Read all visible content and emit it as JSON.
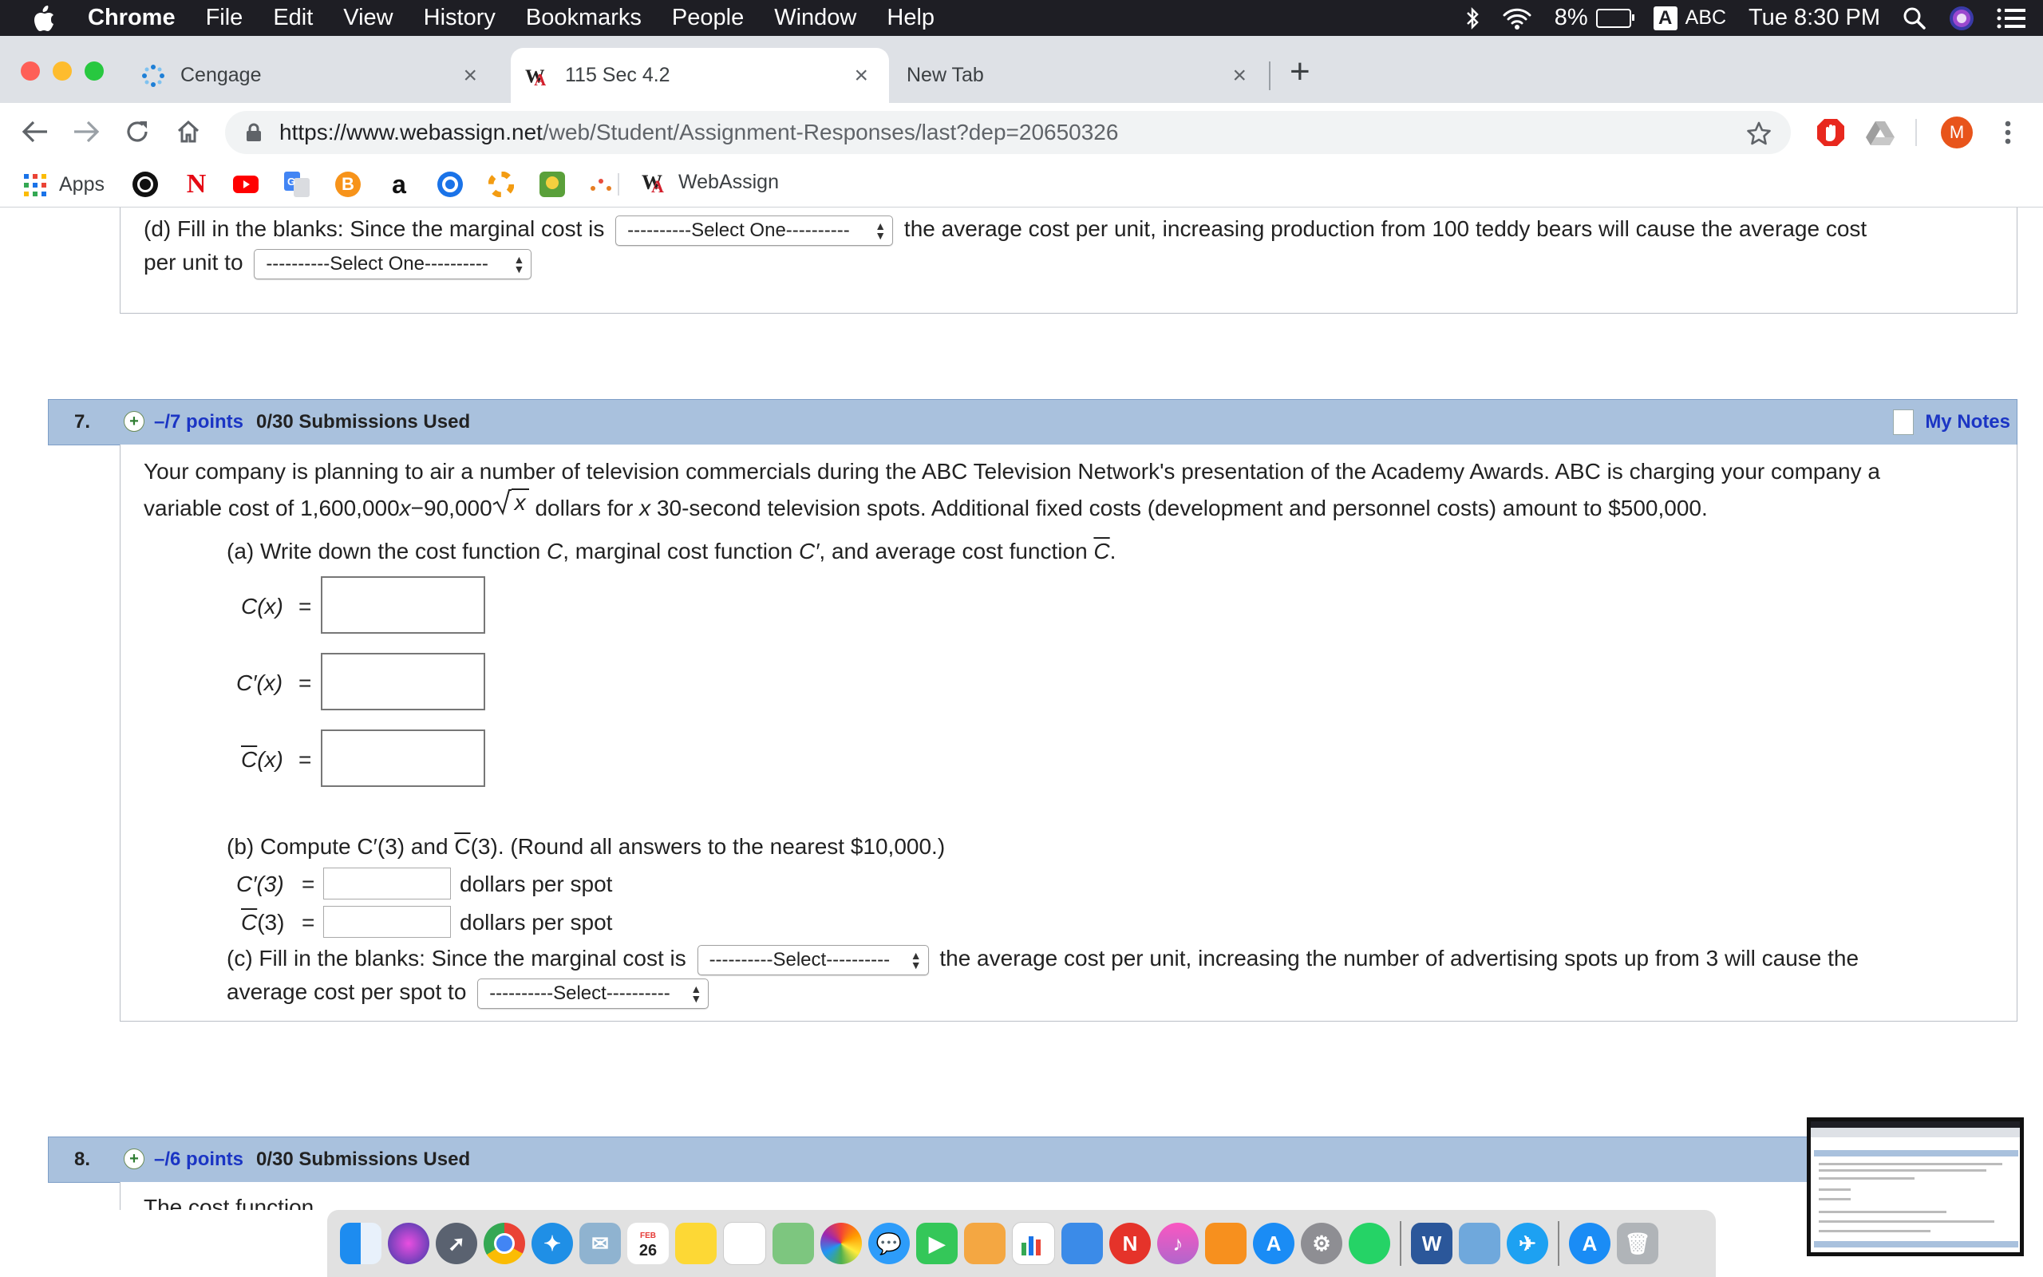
{
  "menubar": {
    "app": "Chrome",
    "items": [
      "File",
      "Edit",
      "View",
      "History",
      "Bookmarks",
      "People",
      "Window",
      "Help"
    ],
    "battery": "8%",
    "input_source": "ABC",
    "input_letter": "A",
    "clock": "Tue 8:30 PM"
  },
  "tabs": [
    {
      "title": "Cengage"
    },
    {
      "title": "115 Sec 4.2"
    },
    {
      "title": "New Tab"
    }
  ],
  "tab_close": "×",
  "new_tab_label": "+",
  "toolbar": {
    "url_host": "https://www.webassign.net",
    "url_path": "/web/Student/Assignment-Responses/last?dep=20650326",
    "profile_initial": "M"
  },
  "bookmarks": {
    "apps_label": "Apps",
    "webassign_label": "WebAssign"
  },
  "prev_question": {
    "part_d_text_1": "(d) Fill in the blanks: Since the marginal cost is",
    "select_1": "----------Select One----------",
    "part_d_text_2": "the average cost per unit, increasing production from 100 teddy bears will cause the average cost",
    "part_d_text_3": "per unit to",
    "select_2": "----------Select One----------"
  },
  "q7": {
    "number": "7.",
    "points": "–/7 points",
    "submissions": "0/30 Submissions Used",
    "my_notes": "My Notes",
    "intro_line1": "Your company is planning to air a number of television commercials during the ABC Television Network's presentation of the Academy Awards. ABC is charging your company a",
    "intro_line2_a": "variable cost of  1,600,000",
    "intro_var_x": "x",
    "intro_line2_b": "−90,000",
    "intro_line2_c": " dollars for ",
    "intro_line2_d": " 30-second television spots. Additional fixed costs (development and personnel costs) amount to $500,000.",
    "part_a_1": "(a) Write down the cost function ",
    "part_a_C": "C",
    "part_a_2": ", marginal cost function ",
    "part_a_Cp": "C′",
    "part_a_3": ", and average cost function  ",
    "part_a_Cbar": "C",
    "part_a_4": ".",
    "fn_C": "C(x)",
    "fn_Cp": "C′(x)",
    "fn_Cbar": "C(x)",
    "eq": "=",
    "part_b_1": "(b) Compute  C′(3)  and ",
    "part_b_Cbar": "C",
    "part_b_2": "(3).  (Round all answers to the nearest $10,000.)",
    "b_Cp3": "C′(3)",
    "b_Cbar3_C": "C",
    "b_Cbar3_rest": "(3)",
    "dollars_per_spot": "dollars per spot",
    "part_c_1": "(c) Fill in the blanks: Since the marginal cost is",
    "select_c1": "----------Select----------",
    "part_c_2": "the average cost per unit, increasing the number of advertising spots up from 3 will cause the",
    "part_c_3": "average cost per spot to",
    "select_c2": "----------Select----------"
  },
  "q8": {
    "number": "8.",
    "points": "–/6 points",
    "submissions": "0/30 Submissions Used",
    "intro_partial": "The cost function"
  },
  "dock": {
    "calendar_day": "26",
    "calendar_month": "FEB",
    "word_letter": "W"
  }
}
